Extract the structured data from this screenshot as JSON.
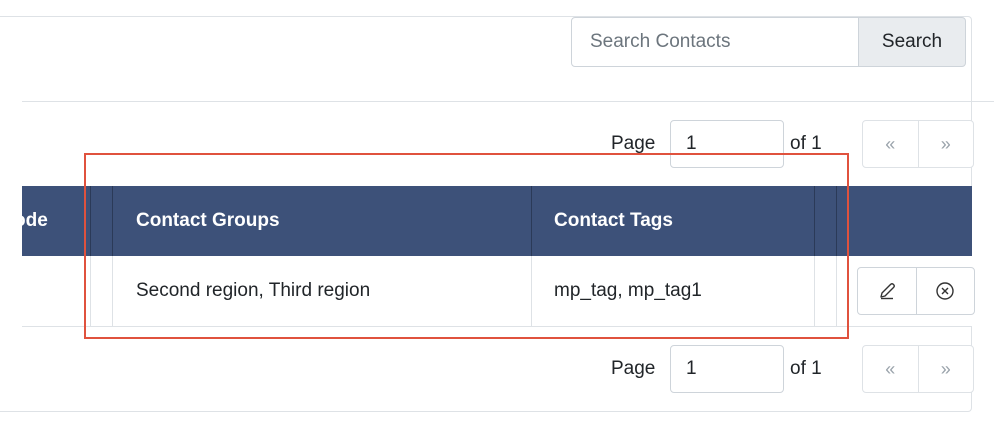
{
  "search": {
    "placeholder": "Search Contacts",
    "button_label": "Search"
  },
  "pagination_top": {
    "page_label": "Page",
    "page_value": "1",
    "of_label": "of 1",
    "prev": "«",
    "next": "»"
  },
  "pagination_bottom": {
    "page_label": "Page",
    "page_value": "1",
    "of_label": "of 1",
    "prev": "«",
    "next": "»"
  },
  "table": {
    "headers": {
      "partial": "ode",
      "groups": "Contact Groups",
      "tags": "Contact Tags"
    },
    "rows": [
      {
        "groups": "Second region, Third region",
        "tags": "mp_tag, mp_tag1"
      }
    ]
  },
  "icons": {
    "edit": "pencil-icon",
    "delete": "circle-x-icon"
  },
  "colors": {
    "header_bg": "#3d5179",
    "highlight": "#e0523e"
  }
}
